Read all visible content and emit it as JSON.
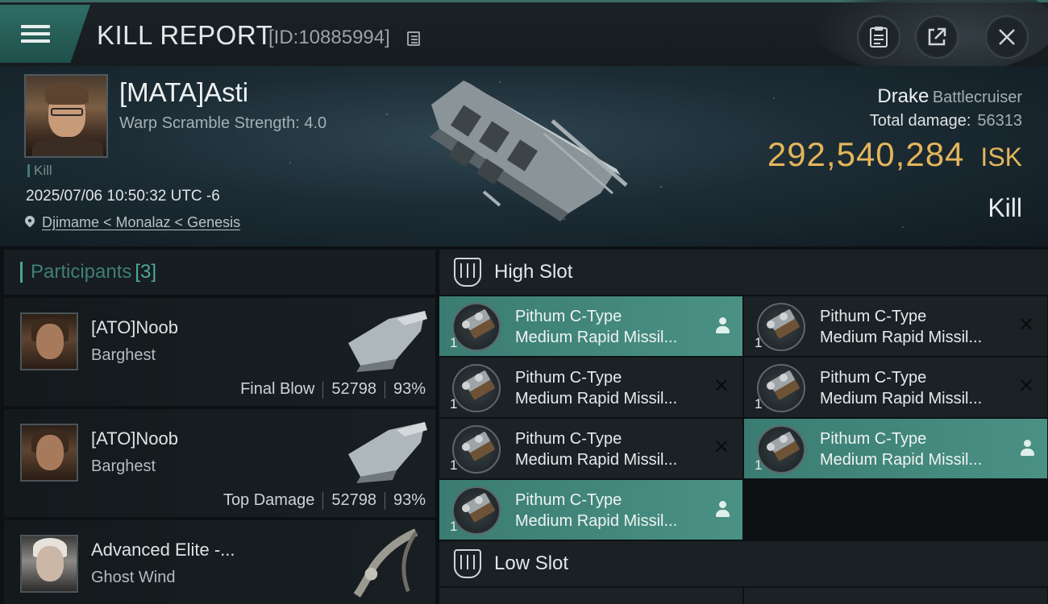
{
  "header": {
    "title": "KILL REPORT",
    "id_text": "[ID:10885994]"
  },
  "victim": {
    "name": "[MATA]Asti",
    "warp": "Warp Scramble Strength: 4.0",
    "kill_tag": "Kill",
    "datetime": "2025/07/06 10:50:32 UTC -6",
    "location": "Djimame < Monalaz < Genesis",
    "ship_name": "Drake",
    "ship_class": "Battlecruiser",
    "total_damage_label": "Total damage:",
    "total_damage_value": "56313",
    "isk_value": "292,540,284",
    "isk_unit": "ISK",
    "result": "Kill"
  },
  "participants": {
    "label": "Participants",
    "count": "[3]",
    "rows": [
      {
        "name": "[ATO]Noob",
        "ship": "Barghest",
        "role": "Final Blow",
        "damage": "52798",
        "percent": "93%"
      },
      {
        "name": "[ATO]Noob",
        "ship": "Barghest",
        "role": "Top Damage",
        "damage": "52798",
        "percent": "93%"
      },
      {
        "name": "Advanced Elite -...",
        "ship": "Ghost Wind"
      }
    ]
  },
  "slots": {
    "high_label": "High Slot",
    "low_label": "Low Slot",
    "high_items": [
      {
        "line1": "Pithum C-Type",
        "line2": "Medium Rapid Missil...",
        "qty": "1",
        "status": "dropped"
      },
      {
        "line1": "Pithum C-Type",
        "line2": "Medium Rapid Missil...",
        "qty": "1",
        "status": "destroyed"
      },
      {
        "line1": "Pithum C-Type",
        "line2": "Medium Rapid Missil...",
        "qty": "1",
        "status": "destroyed"
      },
      {
        "line1": "Pithum C-Type",
        "line2": "Medium Rapid Missil...",
        "qty": "1",
        "status": "destroyed"
      },
      {
        "line1": "Pithum C-Type",
        "line2": "Medium Rapid Missil...",
        "qty": "1",
        "status": "destroyed"
      },
      {
        "line1": "Pithum C-Type",
        "line2": "Medium Rapid Missil...",
        "qty": "1",
        "status": "dropped"
      },
      {
        "line1": "Pithum C-Type",
        "line2": "Medium Rapid Missil...",
        "qty": "1",
        "status": "dropped"
      }
    ]
  },
  "colors": {
    "accent": "#4a9184",
    "isk": "#e4b55a"
  }
}
